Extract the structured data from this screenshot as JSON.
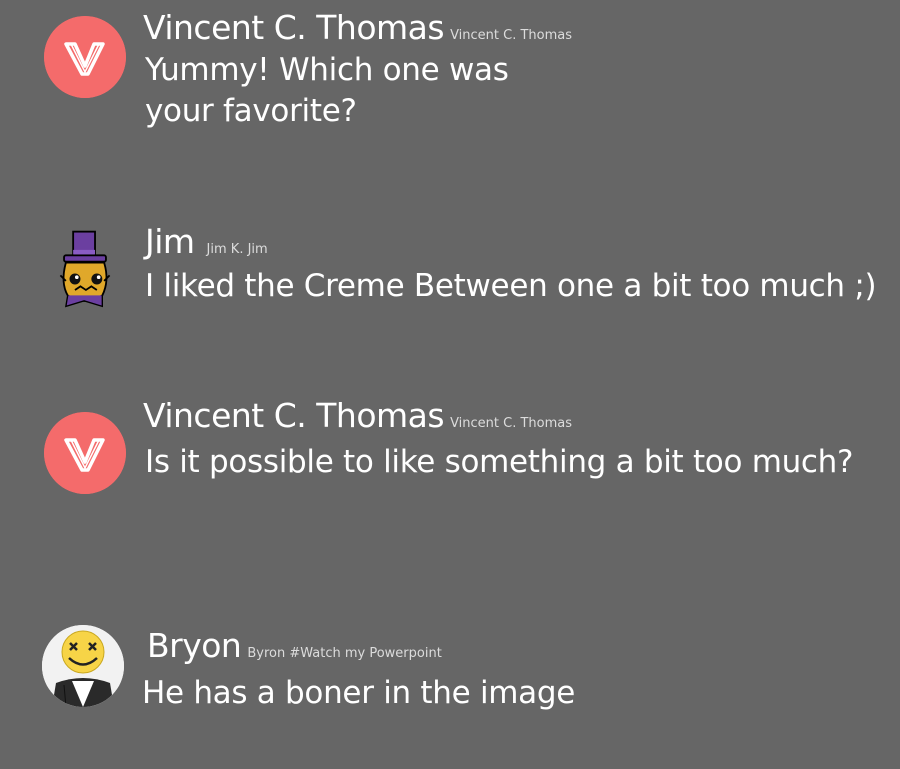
{
  "colors": {
    "background": "#666666",
    "vincent_avatar": "#f46b6b",
    "text": "#ffffff",
    "handle_text": "#dcdcdc"
  },
  "messages": [
    {
      "author": "Vincent C. Thomas",
      "handle": "Vincent C. Thomas",
      "avatar_icon": "v-logo-icon",
      "text_lines": [
        "Yummy! Which one was",
        "your favorite?"
      ]
    },
    {
      "author": "Jim",
      "handle": "Jim K. Jim",
      "avatar_icon": "top-hat-creature-icon",
      "text_lines": [
        "I liked the Creme Between one a bit too much ;)"
      ]
    },
    {
      "author": "Vincent C. Thomas",
      "handle": "Vincent C. Thomas",
      "avatar_icon": "v-logo-icon",
      "text_lines": [
        "Is it possible to like something a bit too much?"
      ]
    },
    {
      "author": "Bryon",
      "handle": "Byron #Watch my Powerpoint",
      "avatar_icon": "x-eyes-smiley-person-icon",
      "text_lines": [
        "He has a boner in the image"
      ]
    }
  ]
}
